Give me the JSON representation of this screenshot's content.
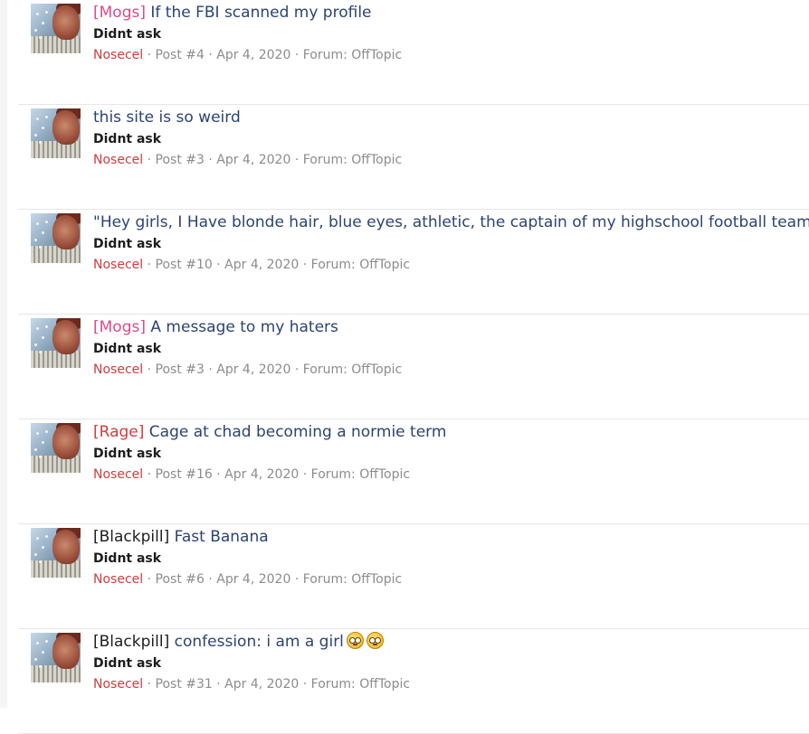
{
  "results": [
    {
      "prefix": "[Mogs]",
      "prefix_color": "#d94c8c",
      "title": " If the FBI scanned my profile",
      "emojis": 0,
      "snippet": "Didnt ask",
      "author": "Nosecel",
      "post": "Post #4",
      "date": "Apr 4, 2020",
      "forum": "Forum: OffTopic"
    },
    {
      "prefix": "",
      "prefix_color": "",
      "title": "this site is so weird",
      "emojis": 0,
      "snippet": "Didnt ask",
      "author": "Nosecel",
      "post": "Post #3",
      "date": "Apr 4, 2020",
      "forum": "Forum: OffTopic"
    },
    {
      "prefix": "",
      "prefix_color": "",
      "title": "\"Hey girls, I Have blonde hair, blue eyes, athletic, the captain of my highschool football team\"",
      "emojis": 0,
      "snippet": "Didnt ask",
      "author": "Nosecel",
      "post": "Post #10",
      "date": "Apr 4, 2020",
      "forum": "Forum: OffTopic"
    },
    {
      "prefix": "[Mogs]",
      "prefix_color": "#d94c8c",
      "title": " A message to my haters",
      "emojis": 0,
      "snippet": "Didnt ask",
      "author": "Nosecel",
      "post": "Post #3",
      "date": "Apr 4, 2020",
      "forum": "Forum: OffTopic"
    },
    {
      "prefix": "[Rage]",
      "prefix_color": "#d23c3c",
      "title": " Cage at chad becoming a normie term",
      "emojis": 0,
      "snippet": "Didnt ask",
      "author": "Nosecel",
      "post": "Post #16",
      "date": "Apr 4, 2020",
      "forum": "Forum: OffTopic"
    },
    {
      "prefix": "[Blackpill]",
      "prefix_color": "#1d1d1d",
      "title": " Fast Banana",
      "emojis": 0,
      "snippet": "Didnt ask",
      "author": "Nosecel",
      "post": "Post #6",
      "date": "Apr 4, 2020",
      "forum": "Forum: OffTopic"
    },
    {
      "prefix": "[Blackpill]",
      "prefix_color": "#1d1d1d",
      "title": " confession: i am a girl",
      "emojis": 2,
      "emoji_name": "flushed-face-icon",
      "snippet": "Didnt ask",
      "author": "Nosecel",
      "post": "Post #31",
      "date": "Apr 4, 2020",
      "forum": "Forum: OffTopic"
    }
  ],
  "separator": " · ",
  "colors": {
    "title": "#2d4373",
    "author": "#d23c3c",
    "meta": "#8c8c8c"
  }
}
